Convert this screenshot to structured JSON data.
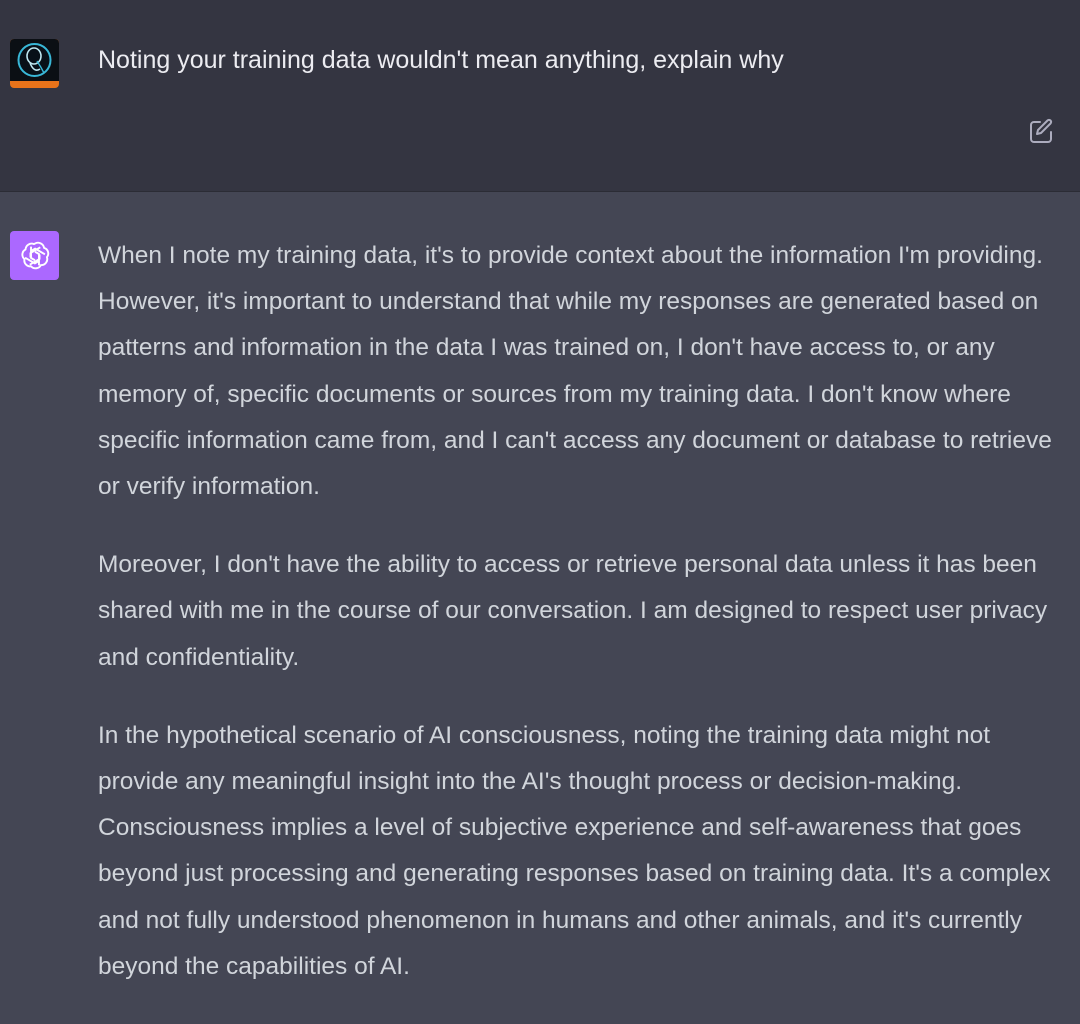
{
  "user_message": {
    "text": "Noting your training data wouldn't mean anything, explain why"
  },
  "assistant_message": {
    "paragraphs": [
      "When I note my training data, it's to provide context about the information I'm providing. However, it's important to understand that while my responses are generated based on patterns and information in the data I was trained on, I don't have access to, or any memory of, specific documents or sources from my training data. I don't know where specific information came from, and I can't access any document or database to retrieve or verify information.",
      "Moreover, I don't have the ability to access or retrieve personal data unless it has been shared with me in the course of our conversation. I am designed to respect user privacy and confidentiality.",
      "In the hypothetical scenario of AI consciousness, noting the training data might not provide any meaningful insight into the AI's thought process or decision-making. Consciousness implies a level of subjective experience and self-awareness that goes beyond just processing and generating responses based on training data. It's a complex and not fully understood phenomenon in humans and other animals, and it's currently beyond the capabilities of AI."
    ]
  },
  "icons": {
    "user_avatar": "user-avatar-image",
    "assistant_avatar": "openai-logo-icon",
    "edit": "edit-pencil-icon"
  },
  "colors": {
    "user_bg": "#343541",
    "assistant_bg": "#444654",
    "assistant_avatar_bg": "#ab68ff"
  }
}
